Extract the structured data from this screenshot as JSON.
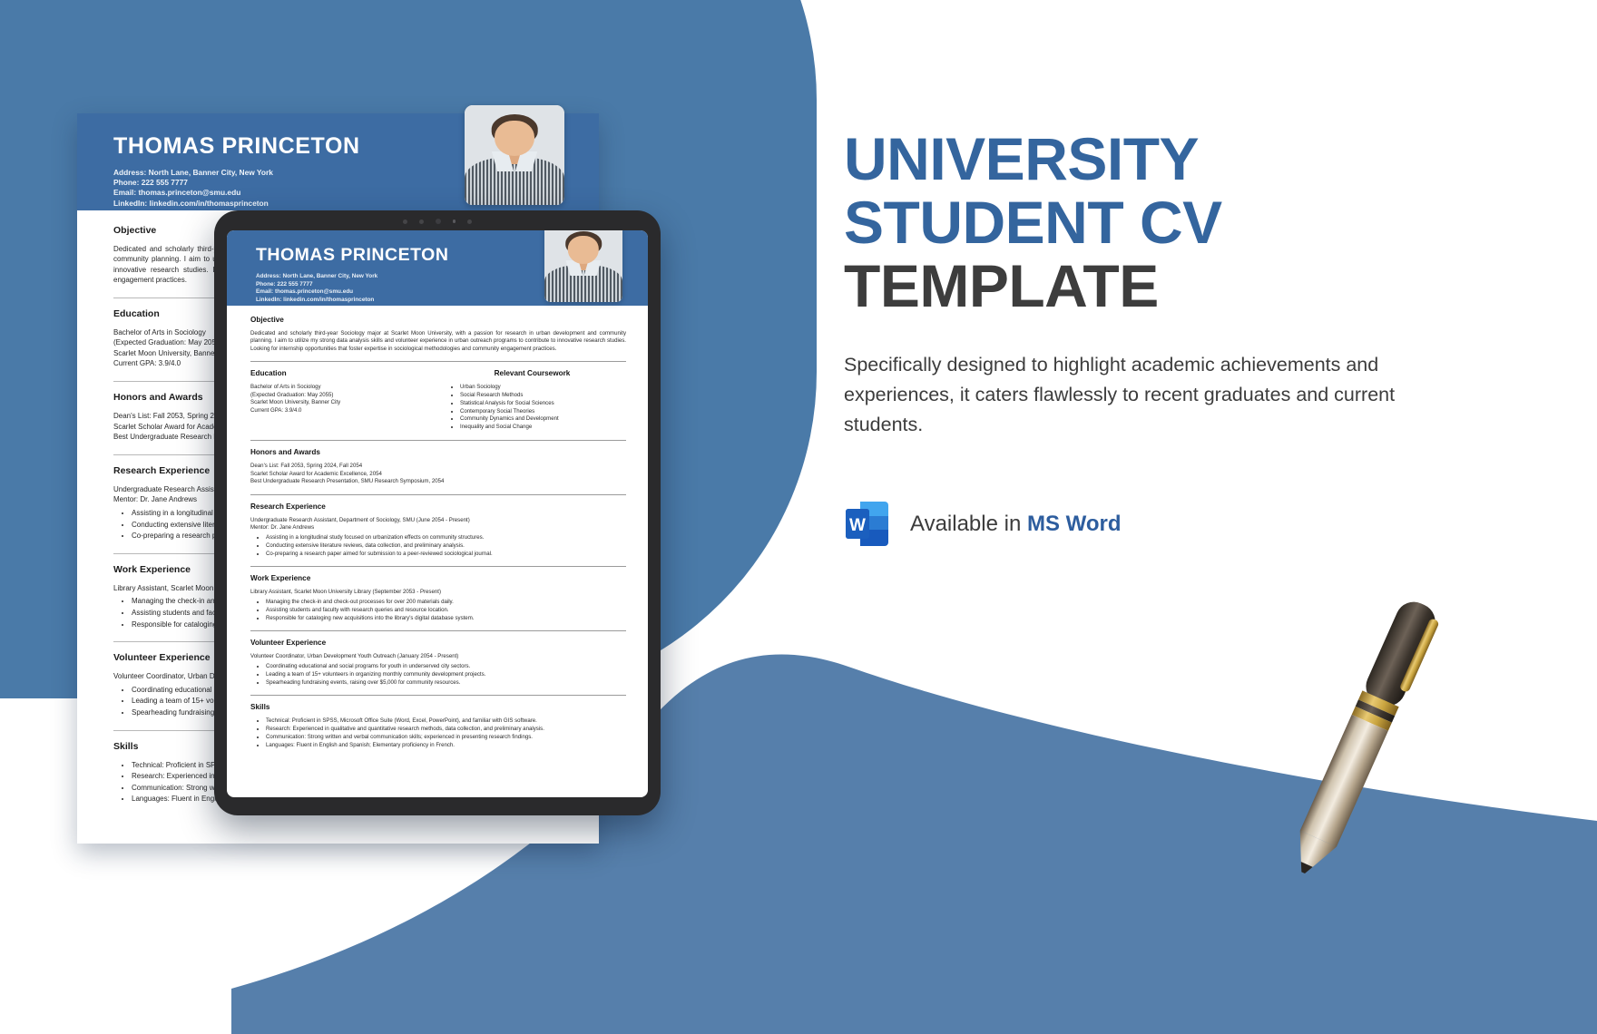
{
  "promo": {
    "title_line1": "UNIVERSITY",
    "title_line2": "STUDENT CV",
    "title_line3": "TEMPLATE",
    "description": "Specifically designed to highlight academic achievements and experiences, it caters flawlessly to recent graduates and current students.",
    "availability_prefix": "Available in ",
    "availability_app": "MS Word",
    "word_logo_letter": "W",
    "colors": {
      "accent_blue": "#34659e",
      "title_dark": "#3d3d3d",
      "background_blue": "#4a7aa8",
      "resume_header_blue": "#3d6ca3",
      "word_blue": "#2d5d9e"
    }
  },
  "resume": {
    "name": "THOMAS PRINCETON",
    "contact": {
      "address": "Address: North Lane, Banner City, New York",
      "phone": "Phone: 222 555 7777",
      "email": "Email: thomas.princeton@smu.edu",
      "linkedin": "LinkedIn: linkedin.com/in/thomasprinceton"
    },
    "sections": {
      "objective": {
        "heading": "Objective",
        "text": "Dedicated and scholarly third-year Sociology major at Scarlet Moon University, with a passion for research in urban development and community planning. I aim to utilize my strong data analysis skills and volunteer experience in urban outreach programs to contribute to innovative research studies. Looking for internship opportunities that foster expertise in sociological methodologies and community engagement practices."
      },
      "education": {
        "heading": "Education",
        "lines": [
          "Bachelor of Arts in Sociology",
          "(Expected Graduation: May 2055)",
          "Scarlet Moon University, Banner City",
          "Current GPA: 3.9/4.0"
        ]
      },
      "coursework": {
        "heading": "Relevant Coursework",
        "items": [
          "Urban Sociology",
          "Social Research Methods",
          "Statistical Analysis for Social Sciences",
          "Contemporary Social Theories",
          "Community Dynamics and Development",
          "Inequality and Social Change"
        ]
      },
      "honors": {
        "heading": "Honors and Awards",
        "lines": [
          "Dean's List: Fall 2053, Spring 2024, Fall 2054",
          "Scarlet Scholar Award for Academic Excellence, 2054",
          "Best Undergraduate Research Presentation, SMU Research Symposium, 2054"
        ]
      },
      "research": {
        "heading": "Research Experience",
        "role": "Undergraduate Research Assistant, Department of Sociology, SMU (June 2054 - Present)",
        "mentor": "Mentor: Dr. Jane Andrews",
        "bullets": [
          "Assisting in a longitudinal study focused on urbanization effects on community structures.",
          "Conducting extensive literature reviews, data collection, and preliminary analysis.",
          "Co-preparing a research paper aimed for submission to a peer-reviewed sociological journal."
        ]
      },
      "work": {
        "heading": "Work Experience",
        "role": "Library Assistant, Scarlet Moon University Library (September 2053 - Present)",
        "bullets": [
          "Managing the check-in and check-out processes for over 200 materials daily.",
          "Assisting students and faculty with research queries and resource location.",
          "Responsible for cataloging new acquisitions into the library's digital database system."
        ]
      },
      "volunteer": {
        "heading": "Volunteer Experience",
        "role": "Volunteer Coordinator, Urban Development Youth Outreach (January 2054 - Present)",
        "bullets": [
          "Coordinating educational and social programs for youth in underserved city sectors.",
          "Leading a team of 15+ volunteers in organizing monthly community development projects.",
          "Spearheading fundraising events, raising over $5,000 for community resources."
        ]
      },
      "skills": {
        "heading": "Skills",
        "bullets": [
          "Technical: Proficient in SPSS, Microsoft Office Suite (Word, Excel, PowerPoint), and familiar with GIS software.",
          "Research: Experienced in qualitative and quantitative research methods, data collection, and preliminary analysis.",
          "Communication: Strong written and verbal communication skills; experienced in presenting research findings.",
          "Languages: Fluent in English and Spanish; Elementary proficiency in French."
        ]
      }
    }
  }
}
